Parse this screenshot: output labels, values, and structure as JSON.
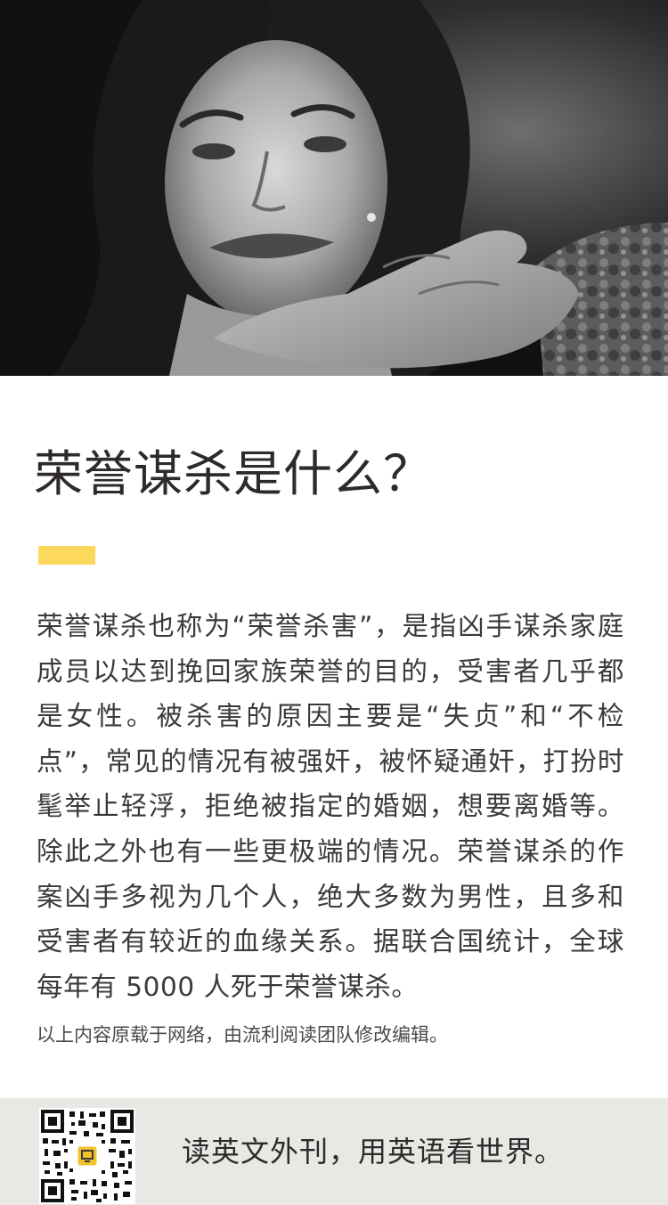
{
  "article": {
    "title": "荣誉谋杀是什么？",
    "body": "荣誉谋杀也称为“荣誉杀害”，是指凶手谋杀家庭成员以达到挽回家族荣誉的目的，受害者几乎都是女性。被杀害的原因主要是“失贞”和“不检点”，常见的情况有被强奸，被怀疑通奸，打扮时髦举止轻浮，拒绝被指定的婚姻，想要离婚等。除此之外也有一些更极端的情况。荣誉谋杀的作案凶手多视为几个人，绝大多数为男性，且多和受害者有较近的血缘关系。据联合国统计，全球每年有 5000 人死于荣誉谋杀。",
    "source_note": "以上内容原载于网络，由流利阅读团队修改编辑。"
  },
  "footer": {
    "slogan": "读英文外刊，用英语看世界。"
  },
  "colors": {
    "accent": "#fcd85c",
    "footer_bg": "#e9e8e4",
    "qr_logo": "#f3c22c"
  }
}
